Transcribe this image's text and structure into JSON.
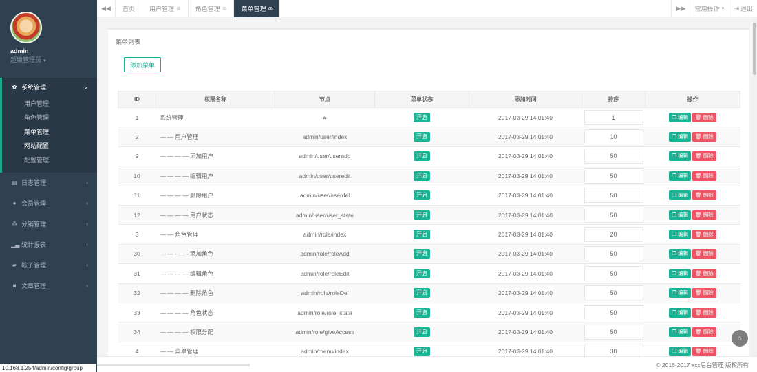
{
  "profile": {
    "name": "admin",
    "role": "超级管理员"
  },
  "nav": {
    "active_group": {
      "label": "系统管理",
      "icon": "gear-icon",
      "items": [
        "用户管理",
        "角色管理",
        "菜单管理",
        "网站配置",
        "配置管理"
      ]
    },
    "groups": [
      {
        "label": "日志管理",
        "icon": "log-icon"
      },
      {
        "label": "会员管理",
        "icon": "user-icon"
      },
      {
        "label": "分销管理",
        "icon": "share-icon"
      },
      {
        "label": "统计报表",
        "icon": "chart-icon"
      },
      {
        "label": "鞍子管理",
        "icon": "book-icon"
      },
      {
        "label": "文章管理",
        "icon": "article-icon"
      }
    ]
  },
  "status_url": "10.168.1.254/admin/config/group",
  "tabs": [
    {
      "label": "首页",
      "closable": false,
      "active": false
    },
    {
      "label": "用户管理",
      "closable": true,
      "active": false
    },
    {
      "label": "角色管理",
      "closable": true,
      "active": false
    },
    {
      "label": "菜单管理",
      "closable": true,
      "active": true
    }
  ],
  "topbar": {
    "common_ops": "常用操作",
    "logout": "退出"
  },
  "panel": {
    "title": "菜单列表",
    "add_button": "添加菜单"
  },
  "table": {
    "headers": [
      "ID",
      "权限名称",
      "节点",
      "菜单状态",
      "添加时间",
      "排序",
      "操作"
    ],
    "status_label": "开启",
    "edit_label": "编辑",
    "delete_label": "删除",
    "rows": [
      {
        "id": "1",
        "name": "系统管理",
        "node": "#",
        "time": "2017-03-29 14:01:40",
        "sort": "1"
      },
      {
        "id": "2",
        "name": "— — 用户管理",
        "node": "admin/user/index",
        "time": "2017-03-29 14:01:40",
        "sort": "10"
      },
      {
        "id": "9",
        "name": "— — — — 添加用户",
        "node": "admin/user/useradd",
        "time": "2017-03-29 14:01:40",
        "sort": "50"
      },
      {
        "id": "10",
        "name": "— — — — 编辑用户",
        "node": "admin/user/useredit",
        "time": "2017-03-29 14:01:40",
        "sort": "50"
      },
      {
        "id": "11",
        "name": "— — — — 删除用户",
        "node": "admin/user/userdel",
        "time": "2017-03-29 14:01:40",
        "sort": "50"
      },
      {
        "id": "12",
        "name": "— — — — 用户状态",
        "node": "admin/user/user_state",
        "time": "2017-03-29 14:01:40",
        "sort": "50"
      },
      {
        "id": "3",
        "name": "— — 角色管理",
        "node": "admin/role/index",
        "time": "2017-03-29 14:01:40",
        "sort": "20"
      },
      {
        "id": "30",
        "name": "— — — — 添加角色",
        "node": "admin/role/roleAdd",
        "time": "2017-03-29 14:01:40",
        "sort": "50"
      },
      {
        "id": "31",
        "name": "— — — — 编辑角色",
        "node": "admin/role/roleEdit",
        "time": "2017-03-29 14:01:40",
        "sort": "50"
      },
      {
        "id": "32",
        "name": "— — — — 删除角色",
        "node": "admin/role/roleDel",
        "time": "2017-03-29 14:01:40",
        "sort": "50"
      },
      {
        "id": "33",
        "name": "— — — — 角色状态",
        "node": "admin/role/role_state",
        "time": "2017-03-29 14:01:40",
        "sort": "50"
      },
      {
        "id": "34",
        "name": "— — — — 权限分配",
        "node": "admin/role/giveAccess",
        "time": "2017-03-29 14:01:40",
        "sort": "50"
      },
      {
        "id": "4",
        "name": "— — 菜单管理",
        "node": "admin/menu/index",
        "time": "2017-03-29 14:01:40",
        "sort": "30"
      }
    ]
  },
  "footer": {
    "copyright": "© 2016-2017 xxx后台管理 版权所有"
  }
}
